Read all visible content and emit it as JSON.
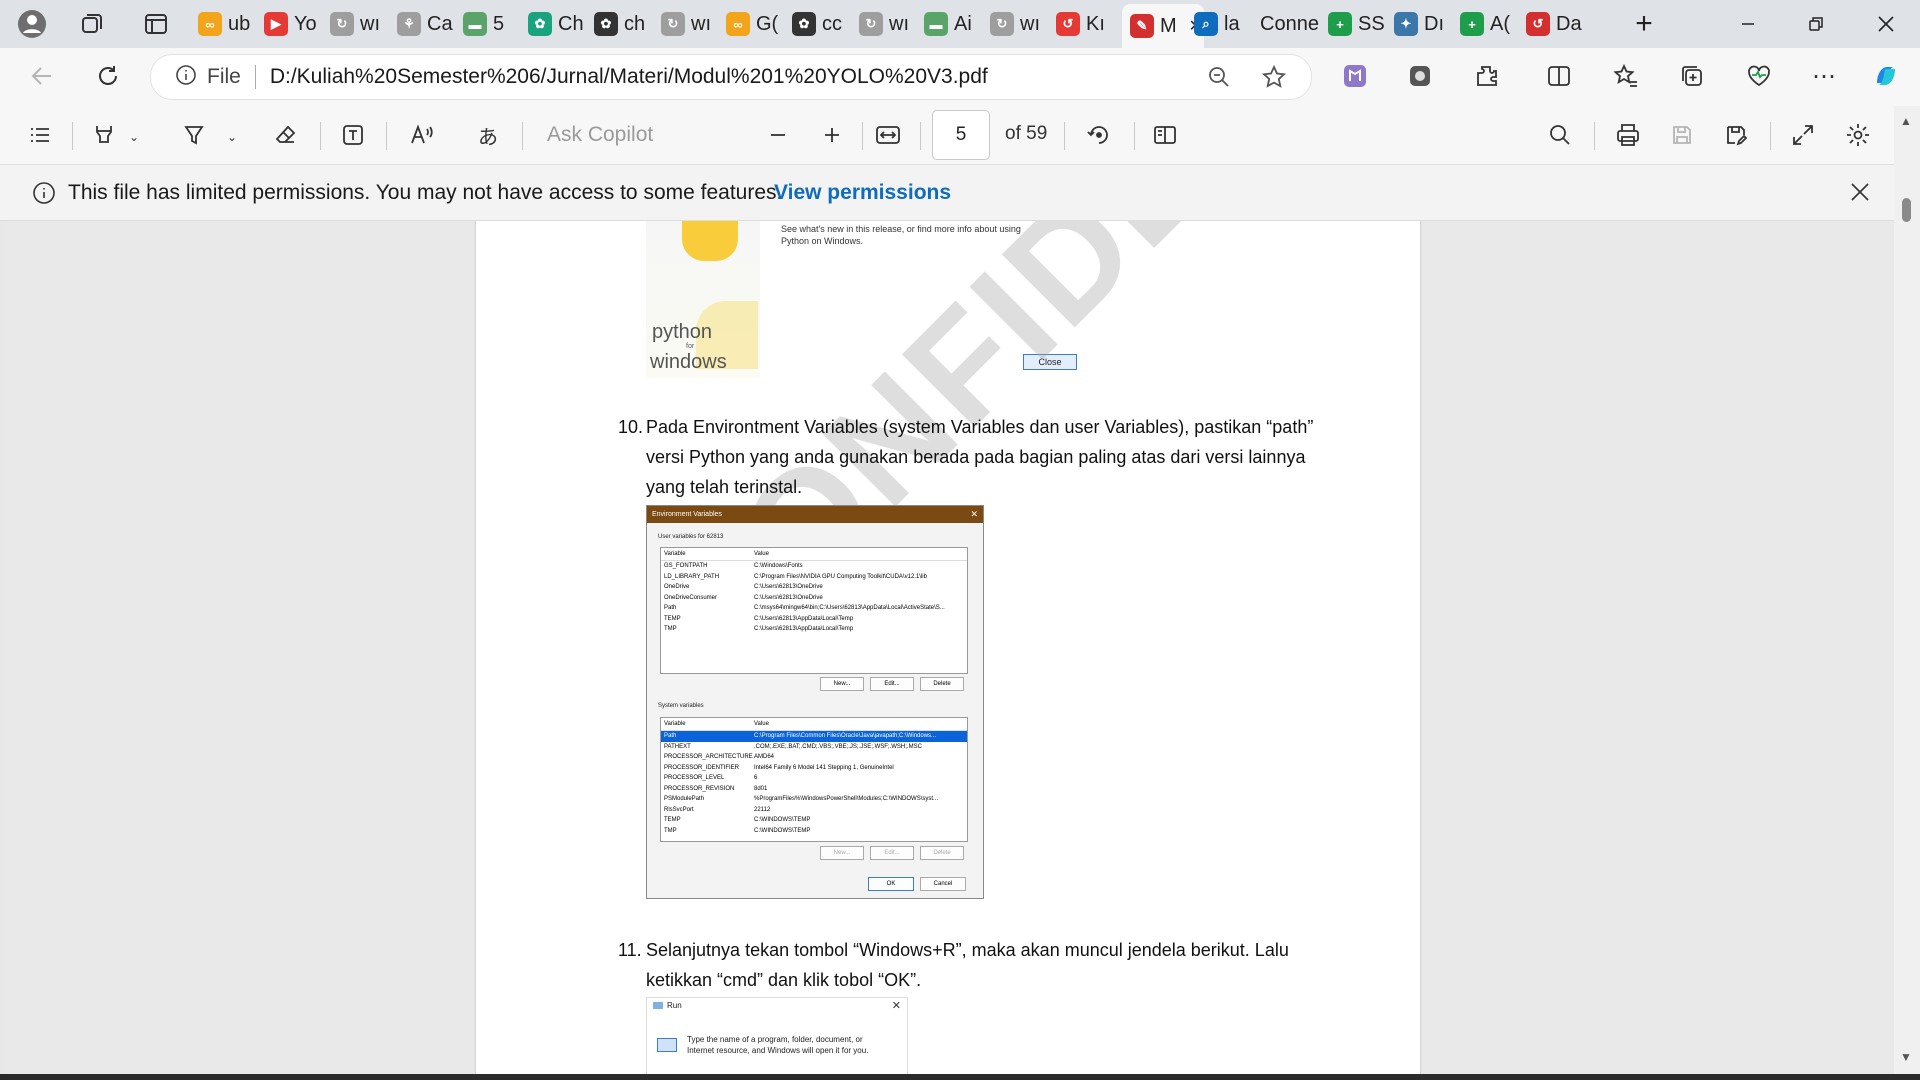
{
  "browser": {
    "tabs": [
      {
        "label": "ub",
        "icon": "cc-icon",
        "color": "#f2a51a"
      },
      {
        "label": "Yo",
        "icon": "youtube-icon",
        "color": "#e53935"
      },
      {
        "label": "wı",
        "icon": "doc-icon",
        "color": "#9e9e9e"
      },
      {
        "label": "Ca",
        "icon": "person-icon",
        "color": "#9e9e9e"
      },
      {
        "label": "5",
        "icon": "sheet-icon",
        "color": "#5aa469"
      },
      {
        "label": "Ch",
        "icon": "chatgpt-icon",
        "color": "#19a37f"
      },
      {
        "label": "ch",
        "icon": "chatgpt-dark-icon",
        "color": "#333333"
      },
      {
        "label": "wı",
        "icon": "doc-icon",
        "color": "#9e9e9e"
      },
      {
        "label": "G(",
        "icon": "cc-icon",
        "color": "#f2a51a"
      },
      {
        "label": "cc",
        "icon": "chatgpt-dark-icon",
        "color": "#333333"
      },
      {
        "label": "wı",
        "icon": "doc-icon",
        "color": "#9e9e9e"
      },
      {
        "label": "Ai",
        "icon": "sheet-icon",
        "color": "#5aa469"
      },
      {
        "label": "wı",
        "icon": "doc-icon",
        "color": "#9e9e9e"
      },
      {
        "label": "Kı",
        "icon": "red-app-icon",
        "color": "#e53935"
      },
      {
        "label": "M",
        "icon": "pdf-icon",
        "color": "#d32f2f",
        "active": true
      },
      {
        "label": "la",
        "icon": "search-icon",
        "color": "#0f6cbd"
      },
      {
        "label": "Conne",
        "icon": "none",
        "color": "#dfe3e8"
      },
      {
        "label": "SS",
        "icon": "plus-green-icon",
        "color": "#1e9e4a"
      },
      {
        "label": "Dı",
        "icon": "python-icon",
        "color": "#3b77a8"
      },
      {
        "label": "A(",
        "icon": "plus-green-icon",
        "color": "#1e9e4a"
      },
      {
        "label": "Da",
        "icon": "red-app-icon",
        "color": "#d32f2f"
      }
    ],
    "address": {
      "file_label": "File",
      "url": "D:/Kuliah%20Semester%206/Jurnal/Materi/Modul%201%20YOLO%20V3.pdf"
    }
  },
  "pdf_toolbar": {
    "ask_copilot": "Ask Copilot",
    "page_current": "5",
    "page_count": "of 59"
  },
  "infobar": {
    "message": "This file has limited permissions. You may not have access to some features.",
    "link": "View permissions"
  },
  "document": {
    "prev_fragment": {
      "text_see": "See what's new in this release, or find more info about using Python on Windows.",
      "logo_text_1": "python",
      "logo_text_2": "for",
      "logo_text_3": "windows",
      "close_button": "Close"
    },
    "step10": {
      "num": "10.",
      "line1": "Pada Environtment Variables (system Variables dan user Variables), pastikan “path”",
      "line2": "versi Python yang anda gunakan berada pada bagian paling atas dari versi lainnya",
      "line3": "yang telah terinstal."
    },
    "env_window": {
      "title": "Environment Variables",
      "user_section": "User variables for 62813",
      "col_variable": "Variable",
      "col_value": "Value",
      "user_rows": [
        [
          "GS_FONTPATH",
          "C:\\Windows\\Fonts"
        ],
        [
          "LD_LIBRARY_PATH",
          "C:\\Program Files\\NVIDIA GPU Computing Toolkit\\CUDA\\v12.1\\lib"
        ],
        [
          "OneDrive",
          "C:\\Users\\62813\\OneDrive"
        ],
        [
          "OneDriveConsumer",
          "C:\\Users\\62813\\OneDrive"
        ],
        [
          "Path",
          "C:\\msys64\\mingw64\\bin;C:\\Users\\62813\\AppData\\Local\\ActiveState\\S..."
        ],
        [
          "TEMP",
          "C:\\Users\\62813\\AppData\\Local\\Temp"
        ],
        [
          "TMP",
          "C:\\Users\\62813\\AppData\\Local\\Temp"
        ]
      ],
      "btn_new": "New...",
      "btn_edit": "Edit...",
      "btn_delete": "Delete",
      "system_section": "System variables",
      "system_rows": [
        [
          "Path",
          "C:\\Program Files\\Common Files\\Oracle\\Java\\javapath;C:\\Windows..."
        ],
        [
          "PATHEXT",
          ".COM;.EXE;.BAT;.CMD;.VBS;.VBE;.JS;.JSE;.WSF;.WSH;.MSC"
        ],
        [
          "PROCESSOR_ARCHITECTURE",
          "AMD64"
        ],
        [
          "PROCESSOR_IDENTIFIER",
          "Intel64 Family 6 Model 141 Stepping 1, GenuineIntel"
        ],
        [
          "PROCESSOR_LEVEL",
          "6"
        ],
        [
          "PROCESSOR_REVISION",
          "8d01"
        ],
        [
          "PSModulePath",
          "%ProgramFiles%\\WindowsPowerShell\\Modules;C:\\WINDOWS\\syst..."
        ],
        [
          "RlsSvcPort",
          "22112"
        ],
        [
          "TEMP",
          "C:\\WINDOWS\\TEMP"
        ],
        [
          "TMP",
          "C:\\WINDOWS\\TEMP"
        ]
      ],
      "btn_ok": "OK",
      "btn_cancel": "Cancel"
    },
    "step11": {
      "num": "11.",
      "line1": "Selanjutnya tekan tombol “Windows+R”, maka akan muncul jendela berikut. Lalu",
      "line2": "ketikkan “cmd” dan klik tobol “OK”."
    },
    "run_window": {
      "title": "Run",
      "text1": "Type the name of a program, folder, document, or",
      "text2": "Internet resource, and Windows will open it for you."
    },
    "watermark": "CONFIDENTIAL"
  }
}
